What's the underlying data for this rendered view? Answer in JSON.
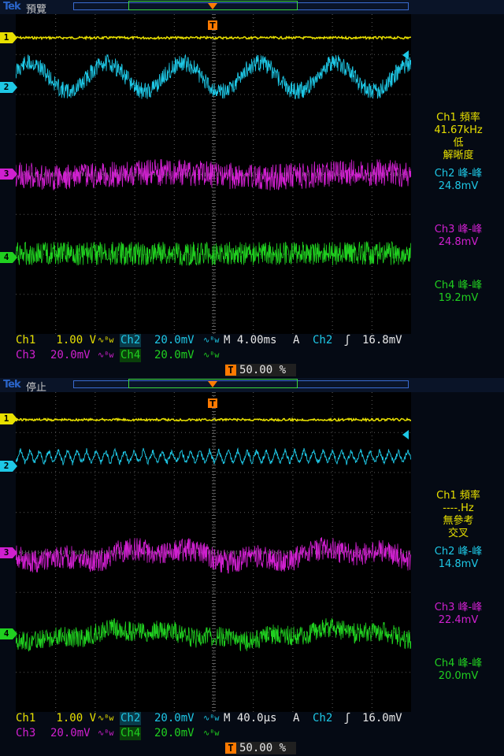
{
  "brand": "Tek",
  "panels": [
    {
      "state": "預覽",
      "readouts": {
        "ch1_title": "Ch1 頻率",
        "ch1_value": "41.67kHz",
        "ch1_note1": "低",
        "ch1_note2": "解晰度",
        "ch2_title": "Ch2 峰-峰",
        "ch2_value": "24.8mV",
        "ch3_title": "Ch3 峰-峰",
        "ch3_value": "24.8mV",
        "ch4_title": "Ch4 峰-峰",
        "ch4_value": "19.2mV"
      },
      "status": {
        "ch1": "Ch1",
        "ch1_scale": "1.00 V",
        "ch2": "Ch2",
        "ch2_scale": "20.0mV",
        "ch3": "Ch3",
        "ch3_scale": "20.0mV",
        "ch4": "Ch4",
        "ch4_scale": "20.0mV",
        "timebase": "M 4.00ms",
        "trig_mode": "A",
        "trig_source": "Ch2",
        "trig_level": "16.8mV",
        "trig_position": "50.00 %"
      }
    },
    {
      "state": "停止",
      "readouts": {
        "ch1_title": "Ch1 頻率",
        "ch1_value": "----.Hz",
        "ch1_note1": "無參考",
        "ch1_note2": "交叉",
        "ch2_title": "Ch2 峰-峰",
        "ch2_value": "14.8mV",
        "ch3_title": "Ch3 峰-峰",
        "ch3_value": "22.4mV",
        "ch4_title": "Ch4 峰-峰",
        "ch4_value": "20.0mV"
      },
      "status": {
        "ch1": "Ch1",
        "ch1_scale": "1.00 V",
        "ch2": "Ch2",
        "ch2_scale": "20.0mV",
        "ch3": "Ch3",
        "ch3_scale": "20.0mV",
        "ch4": "Ch4",
        "ch4_scale": "20.0mV",
        "timebase": "M 40.0µs",
        "trig_mode": "A",
        "trig_source": "Ch2",
        "trig_level": "16.0mV",
        "trig_position": "50.00 %"
      }
    }
  ],
  "channel_markers": [
    "1",
    "2",
    "3",
    "4"
  ],
  "coupling_glyph": "∿ᴮw",
  "trigger_badge": "T",
  "colors": {
    "ch1": "#e8e000",
    "ch2": "#1ec8e6",
    "ch3": "#d020d0",
    "ch4": "#20d020",
    "trigger": "#ff7a00",
    "grid": "#5a5a5a"
  }
}
